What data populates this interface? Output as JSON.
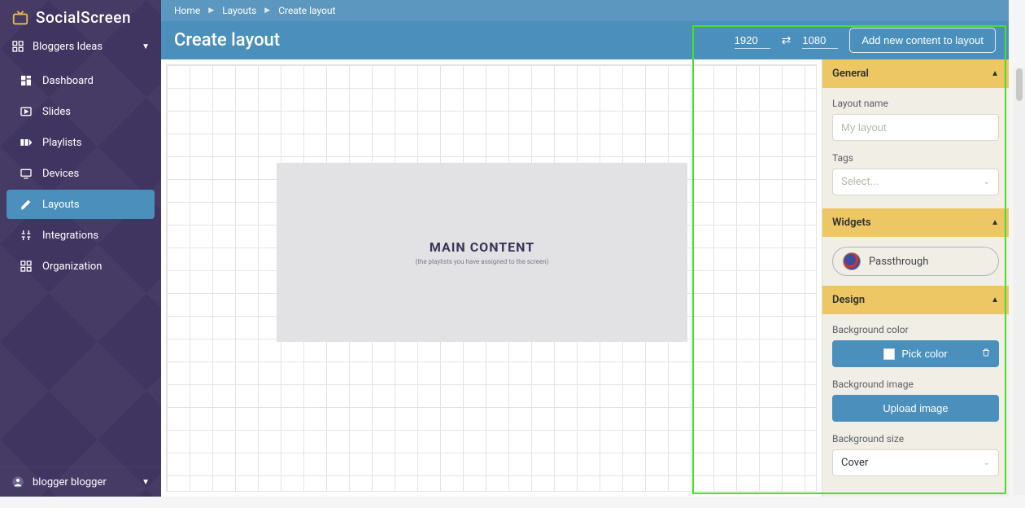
{
  "brand": {
    "name": "SocialScreen"
  },
  "org": {
    "name": "Bloggers Ideas"
  },
  "nav": {
    "items": [
      {
        "key": "dashboard",
        "label": "Dashboard"
      },
      {
        "key": "slides",
        "label": "Slides"
      },
      {
        "key": "playlists",
        "label": "Playlists"
      },
      {
        "key": "devices",
        "label": "Devices"
      },
      {
        "key": "layouts",
        "label": "Layouts",
        "active": true
      },
      {
        "key": "integrations",
        "label": "Integrations"
      },
      {
        "key": "organization",
        "label": "Organization"
      }
    ]
  },
  "user": {
    "name": "blogger blogger"
  },
  "breadcrumb": [
    "Home",
    "Layouts",
    "Create layout"
  ],
  "topbar": {
    "title": "Create layout",
    "width": "1920",
    "height": "1080",
    "addButton": "Add new content to layout"
  },
  "canvas": {
    "mainTitle": "MAIN CONTENT",
    "mainSub": "(the playlists you have assigned to the screen)"
  },
  "panel": {
    "general": {
      "header": "General",
      "layoutNameLabel": "Layout name",
      "layoutNamePlaceholder": "My layout",
      "tagsLabel": "Tags",
      "tagsPlaceholder": "Select..."
    },
    "widgets": {
      "header": "Widgets",
      "items": [
        {
          "label": "Passthrough"
        }
      ]
    },
    "design": {
      "header": "Design",
      "bgColorLabel": "Background color",
      "pickColor": "Pick color",
      "bgImageLabel": "Background image",
      "uploadImage": "Upload image",
      "bgSizeLabel": "Background size",
      "bgSizeValue": "Cover"
    }
  }
}
